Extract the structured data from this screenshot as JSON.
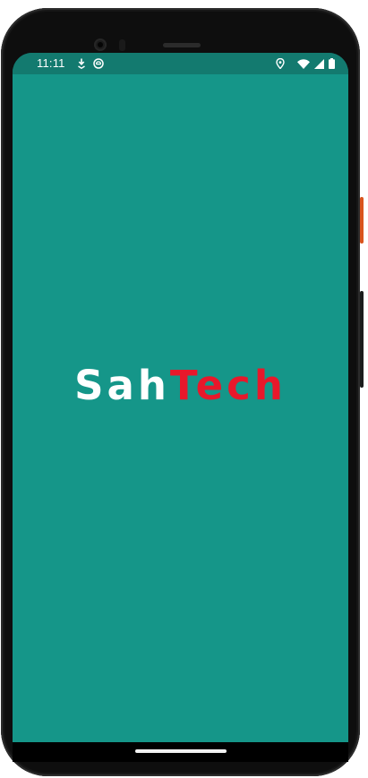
{
  "status_bar": {
    "time": "11:11",
    "left_icons": [
      "download-icon",
      "app-notification-icon"
    ],
    "right_icons": [
      "location-icon",
      "wifi-icon",
      "cell-signal-icon",
      "battery-icon"
    ]
  },
  "logo": {
    "part_a": "Sah",
    "part_b": "Tech"
  },
  "colors": {
    "background": "#159689",
    "status_bar": "#137a6f",
    "logo_primary": "#ffffff",
    "logo_accent": "#e8182b"
  }
}
